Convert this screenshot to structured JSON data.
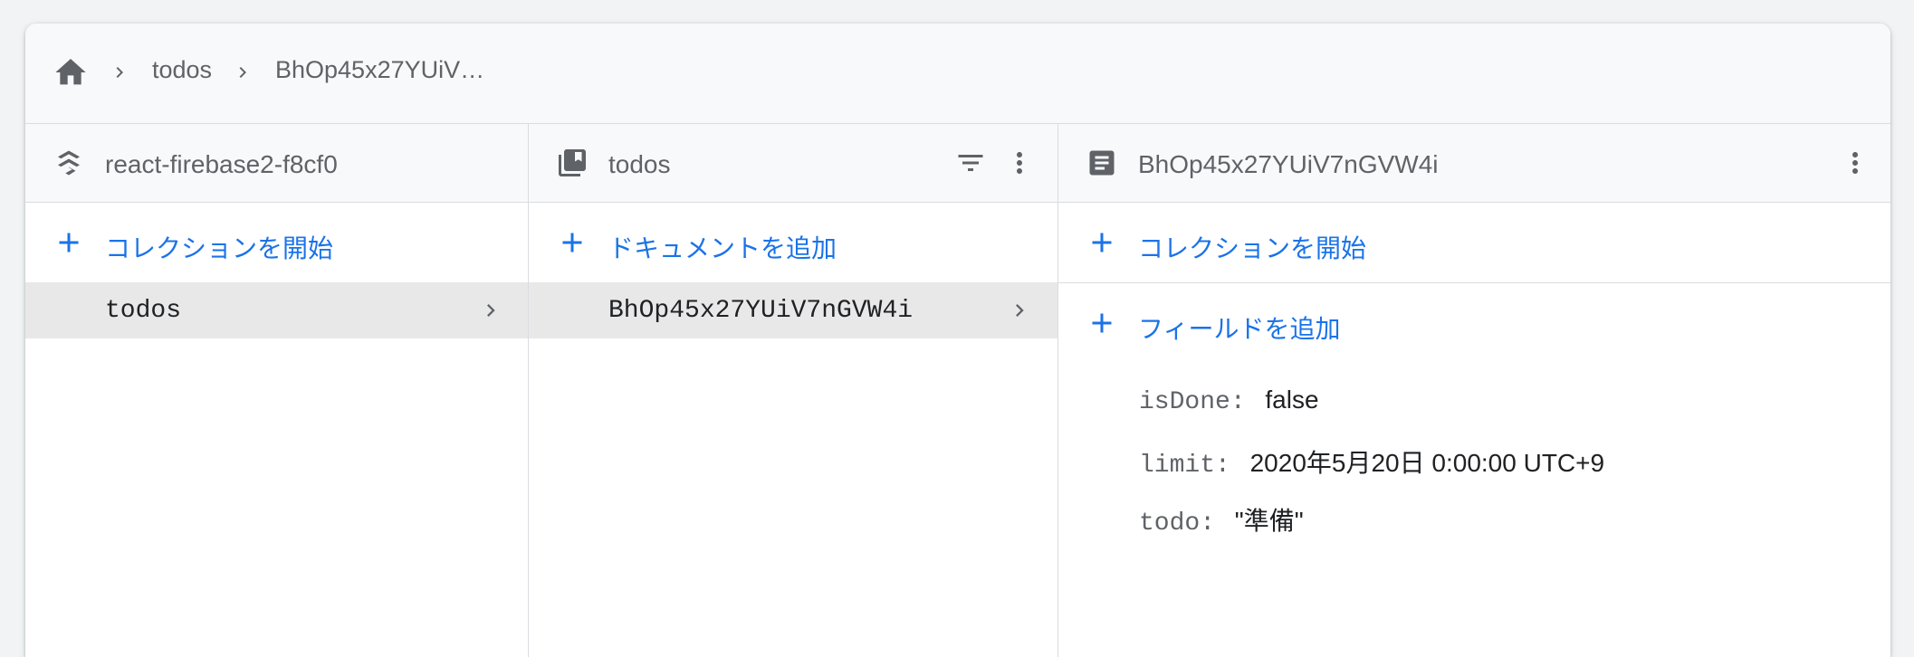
{
  "breadcrumb": {
    "home_icon": "home-icon",
    "items": [
      "todos",
      "BhOp45x27YUiV…"
    ]
  },
  "columns": {
    "project": {
      "title": "react-firebase2-f8cf0",
      "icon": "firestore-icon",
      "add_label": "コレクションを開始",
      "selected": "todos"
    },
    "collection": {
      "title": "todos",
      "icon": "collection-icon",
      "add_label": "ドキュメントを追加",
      "selected": "BhOp45x27YUiV7nGVW4i"
    },
    "document": {
      "title": "BhOp45x27YUiV7nGVW4i",
      "icon": "document-icon",
      "add_collection_label": "コレクションを開始",
      "add_field_label": "フィールドを追加",
      "fields": [
        {
          "key": "isDone:",
          "value": "false"
        },
        {
          "key": "limit:",
          "value": "2020年5月20日 0:00:00 UTC+9"
        },
        {
          "key": "todo:",
          "value": "\"準備\""
        }
      ]
    }
  },
  "colors": {
    "accent": "#1a73e8",
    "selected_row": "#e8e8e8",
    "header_bg": "#f8f9fa",
    "border": "#dadce0"
  }
}
